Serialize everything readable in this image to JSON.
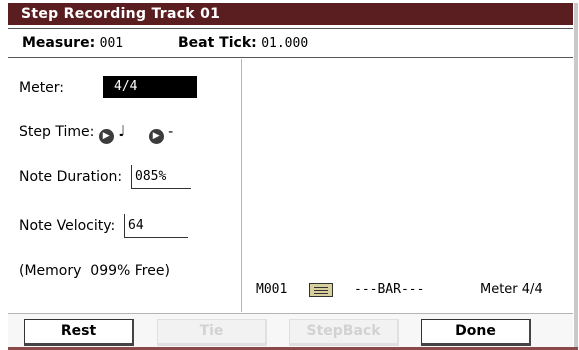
{
  "dialog": {
    "title": "Step Recording Track 01"
  },
  "info": {
    "measure_label": "Measure:",
    "measure_value": "001",
    "beat_tick_label": "Beat Tick:",
    "beat_tick_value": "01.000"
  },
  "params": {
    "meter_label": "Meter:",
    "meter_value": "4/4",
    "step_time_label": "Step Time:",
    "step_time_note": "♩",
    "step_time_mod": "-",
    "note_duration_label": "Note Duration:",
    "note_duration_value": "085%",
    "note_velocity_label": "Note Velocity:",
    "note_velocity_value": "64",
    "memory_text": "(Memory  099% Free)"
  },
  "status": {
    "measure": "M001",
    "bar": "---BAR---",
    "meter": "Meter 4/4"
  },
  "buttons": {
    "rest": "Rest",
    "tie": "Tie",
    "stepback": "StepBack",
    "done": "Done"
  },
  "colors": {
    "titlebar": "#5a1e20",
    "meter_box": "#000000",
    "bar_icon": "#d8cf9e",
    "disabled_text": "#d2d2d2"
  }
}
